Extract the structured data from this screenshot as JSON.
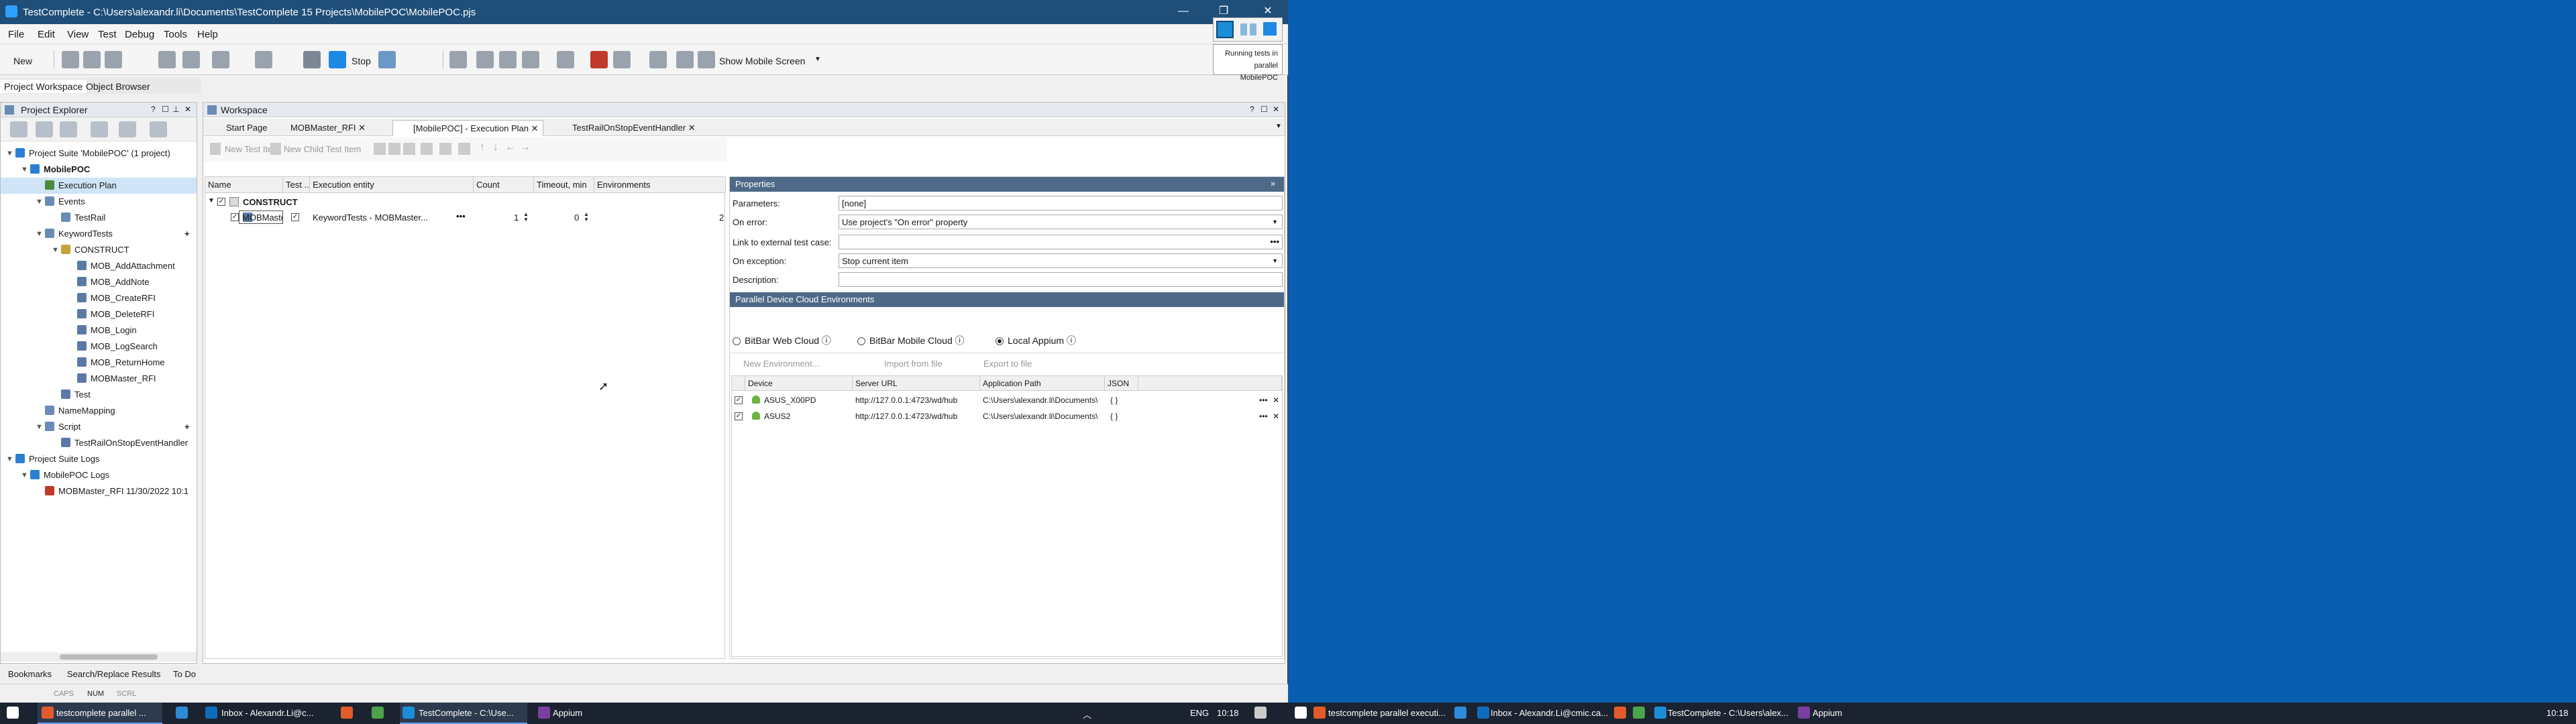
{
  "window": {
    "title": "TestComplete - C:\\Users\\alexandr.li\\Documents\\TestComplete 15 Projects\\MobilePOC\\MobilePOC.pjs",
    "controls": [
      "—",
      "❐",
      "✕"
    ]
  },
  "menu": [
    "File",
    "Edit",
    "View",
    "Test",
    "Debug",
    "Tools",
    "Help"
  ],
  "toolbar": {
    "new_label": "New",
    "stop_label": "Stop",
    "mobile_label": "Show Mobile Screen"
  },
  "run_popup": {
    "line1": "Running tests in parallel",
    "line2": "MobilePOC"
  },
  "left_tabs": [
    "Project Workspace",
    "Object Browser"
  ],
  "explorer": {
    "title": "Project Explorer",
    "tree": [
      {
        "label": "Project Suite 'MobilePOC' (1 project)",
        "level": 0,
        "color": "#2a7fd4"
      },
      {
        "label": "MobilePOC",
        "level": 1,
        "color": "#2a7fd4",
        "bold": true
      },
      {
        "label": "Execution Plan",
        "level": 2,
        "color": "#4a8a3c",
        "selected": true
      },
      {
        "label": "Events",
        "level": 2,
        "color": "#6a8bb5"
      },
      {
        "label": "TestRail",
        "level": 3,
        "color": "#6a8bb5"
      },
      {
        "label": "KeywordTests",
        "level": 2,
        "color": "#6a8bb5"
      },
      {
        "label": "CONSTRUCT",
        "level": 3,
        "color": "#c9a33a"
      },
      {
        "label": "MOB_AddAttachment",
        "level": 4,
        "color": "#5a7aa5"
      },
      {
        "label": "MOB_AddNote",
        "level": 4,
        "color": "#5a7aa5"
      },
      {
        "label": "MOB_CreateRFI",
        "level": 4,
        "color": "#5a7aa5"
      },
      {
        "label": "MOB_DeleteRFI",
        "level": 4,
        "color": "#5a7aa5"
      },
      {
        "label": "MOB_Login",
        "level": 4,
        "color": "#5a7aa5"
      },
      {
        "label": "MOB_LogSearch",
        "level": 4,
        "color": "#5a7aa5"
      },
      {
        "label": "MOB_ReturnHome",
        "level": 4,
        "color": "#5a7aa5"
      },
      {
        "label": "MOBMaster_RFI",
        "level": 4,
        "color": "#5a7aa5"
      },
      {
        "label": "Test",
        "level": 3,
        "color": "#5a7aa5"
      },
      {
        "label": "NameMapping",
        "level": 2,
        "color": "#6a8bb5"
      },
      {
        "label": "Script",
        "level": 2,
        "color": "#6a8bb5"
      },
      {
        "label": "TestRailOnStopEventHandler",
        "level": 3,
        "color": "#5a7aa5"
      },
      {
        "label": "Project Suite Logs",
        "level": 0,
        "color": "#2a7fd4"
      },
      {
        "label": "MobilePOC Logs",
        "level": 1,
        "color": "#2a7fd4"
      },
      {
        "label": "MOBMaster_RFI 11/30/2022 10:1",
        "level": 2,
        "color": "#c0392b"
      }
    ]
  },
  "bottom_tabs": [
    "Bookmarks",
    "Search/Replace Results",
    "To Do"
  ],
  "status": [
    "CAPS",
    "NUM",
    "SCRL"
  ],
  "workspace": {
    "title": "Workspace",
    "tabs": [
      "Start Page",
      "MOBMaster_RFI",
      "[MobilePOC] - Execution Plan",
      "TestRailOnStopEventHandler"
    ],
    "plan_toolbar": {
      "new_item": "New Test Item",
      "new_child": "New Child Test Item"
    },
    "columns": [
      "Name",
      "Test ...",
      "Execution entity",
      "Count",
      "Timeout, min",
      "Environments"
    ],
    "rows": [
      {
        "name": "CONSTRUCT",
        "entity": "",
        "count": "",
        "timeout": "",
        "env": ""
      },
      {
        "name": "MOBMaster_RFI",
        "entity": "KeywordTests - MOBMaster...",
        "count": "1",
        "timeout": "0",
        "env": "2"
      }
    ]
  },
  "properties": {
    "title": "Properties",
    "fields": [
      {
        "label": "Parameters:",
        "value": "[none]"
      },
      {
        "label": "On error:",
        "value": "Use project's \"On error\" property"
      },
      {
        "label": "Link to external test case:",
        "value": ""
      },
      {
        "label": "On exception:",
        "value": "Stop current item"
      },
      {
        "label": "Description:",
        "value": ""
      }
    ],
    "parallel_title": "Parallel Device Cloud Environments",
    "radios": [
      {
        "label": "BitBar Web Cloud",
        "selected": false
      },
      {
        "label": "BitBar Mobile Cloud",
        "selected": false
      },
      {
        "label": "Local Appium",
        "selected": true
      }
    ],
    "env_toolbar": [
      "New Environment...",
      "Import from file",
      "Export to file"
    ],
    "device_columns": [
      "Device",
      "Server URL",
      "Application Path",
      "JSON"
    ],
    "devices": [
      {
        "device": "ASUS_X00PD",
        "url": "http://127.0.0.1:4723/wd/hub",
        "path": "C:\\Users\\alexandr.li\\Documents\\",
        "json": "{ }"
      },
      {
        "device": "ASUS2",
        "url": "http://127.0.0.1:4723/wd/hub",
        "path": "C:\\Users\\alexandr.li\\Documents\\",
        "json": "{ }"
      }
    ]
  },
  "taskbar1": {
    "items": [
      "testcomplete parallel ...",
      "Inbox - Alexandr.Li@c...",
      "TestComplete - C:\\Use...",
      "Appium"
    ],
    "lang": "ENG",
    "time": "10:18"
  },
  "taskbar2": {
    "items": [
      "testcomplete parallel executi...",
      "Inbox - Alexandr.Li@cmic.ca...",
      "TestComplete - C:\\Users\\alex...",
      "Appium"
    ],
    "time": "10:18"
  }
}
